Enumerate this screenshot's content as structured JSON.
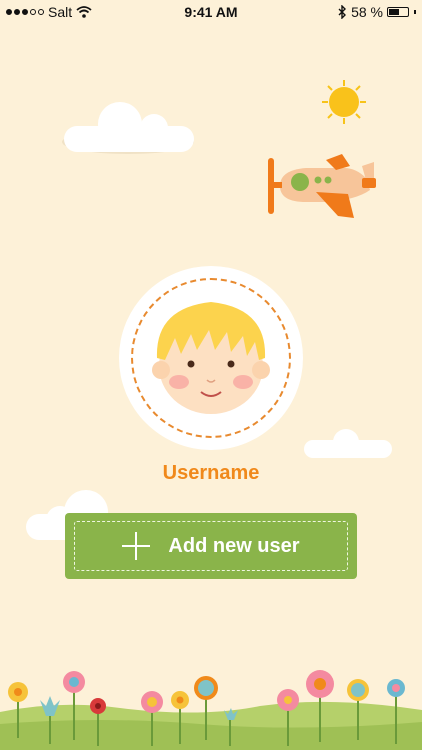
{
  "status_bar": {
    "carrier": "Salt",
    "time": "9:41 AM",
    "battery_percent": "58 %",
    "battery_level": 0.58,
    "signal_dots_filled": 3,
    "signal_dots_total": 5
  },
  "profile": {
    "username": "Username"
  },
  "actions": {
    "add_user_label": "Add new user"
  },
  "colors": {
    "background": "#fdf1d8",
    "accent_orange": "#f0891b",
    "button_green": "#8ab44a"
  }
}
